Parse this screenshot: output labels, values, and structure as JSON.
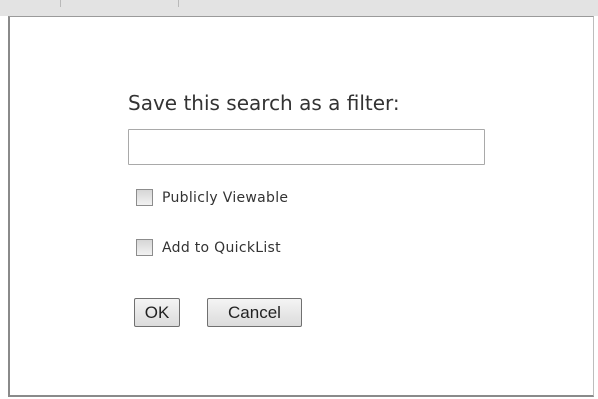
{
  "dialog": {
    "title": "Save this search as a filter:",
    "filter_name": {
      "value": "",
      "placeholder": ""
    },
    "options": [
      {
        "label": "Publicly Viewable",
        "checked": false
      },
      {
        "label": "Add to QuickList",
        "checked": false
      }
    ],
    "ok_label": "OK",
    "cancel_label": "Cancel"
  },
  "colors": {
    "text": "#333333",
    "border": "#a9a9a9",
    "button_bg": "#e8e8e8"
  }
}
